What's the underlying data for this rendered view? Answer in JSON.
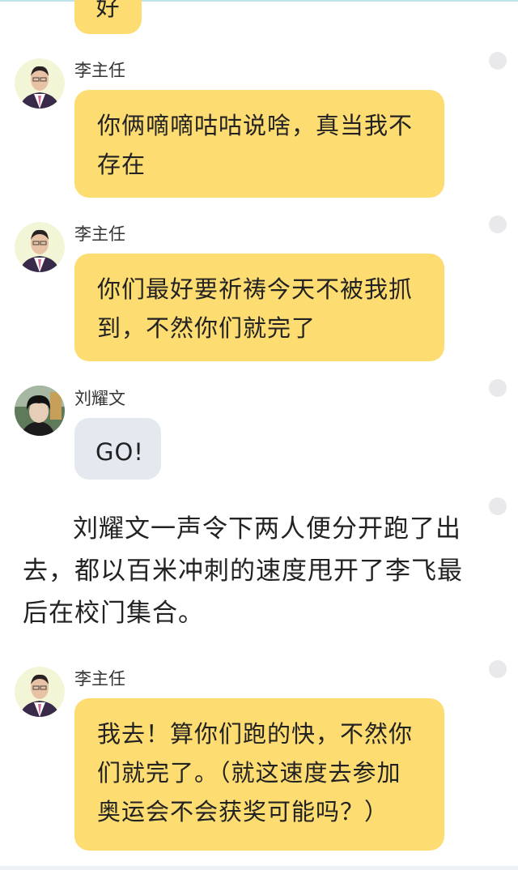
{
  "story": {
    "top_fragment": "好",
    "messages": [
      {
        "id": "m1",
        "speaker": "李主任",
        "avatar": "avatar-li-zhuren",
        "text": "你俩嘀嘀咕咕说啥，真当我不存在"
      },
      {
        "id": "m2",
        "speaker": "李主任",
        "avatar": "avatar-li-zhuren",
        "text": "你们最好要祈祷今天不被我抓到，不然你们就完了"
      },
      {
        "id": "m3",
        "speaker": "刘耀文",
        "avatar": "avatar-liu-yaowen",
        "text": "GO!"
      },
      {
        "id": "m4",
        "speaker": "李主任",
        "avatar": "avatar-li-zhuren",
        "text": "我去！算你们跑的快，不然你们就完了。（就这速度去参加奥运会不会获奖可能吗？）"
      }
    ],
    "narration": "刘耀文一声令下两人便分开跑了出去，都以百米冲刺的速度甩开了李飞最后在校门集合。"
  },
  "colors": {
    "bubble_yellow": "#fddc71",
    "bubble_gray": "#e4e8ef",
    "menu_dot": "#e9e9ec"
  }
}
